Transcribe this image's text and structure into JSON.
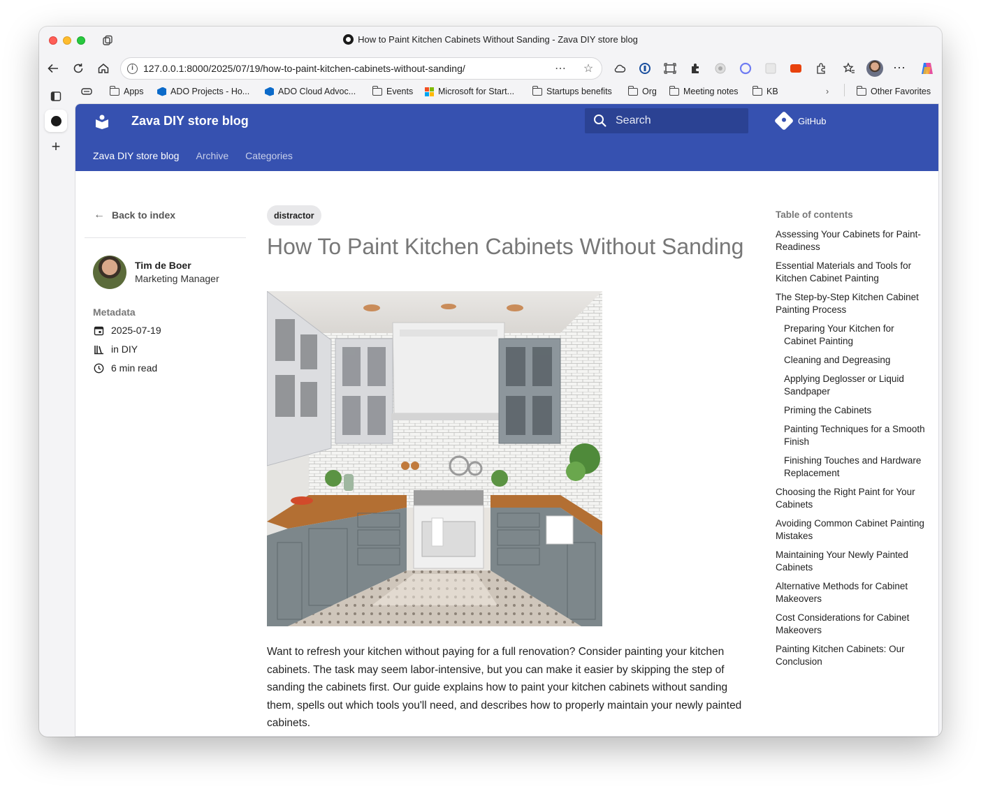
{
  "window": {
    "title": "How to Paint Kitchen Cabinets Without Sanding - Zava DIY store blog"
  },
  "browser": {
    "url": "127.0.0.1:8000/2025/07/19/how-to-paint-kitchen-cabinets-without-sanding/",
    "bookmarks": [
      {
        "label": "Apps",
        "icon": "folder-icon"
      },
      {
        "label": "ADO Projects - Ho...",
        "icon": "azure-devops-icon"
      },
      {
        "label": "ADO Cloud Advoc...",
        "icon": "azure-devops-icon"
      },
      {
        "label": "Events",
        "icon": "folder-icon"
      },
      {
        "label": "Microsoft for Start...",
        "icon": "microsoft-icon"
      },
      {
        "label": "Startups benefits",
        "icon": "folder-icon"
      },
      {
        "label": "Org",
        "icon": "folder-icon"
      },
      {
        "label": "Meeting notes",
        "icon": "folder-icon"
      },
      {
        "label": "KB",
        "icon": "folder-icon"
      }
    ],
    "other_favorites": "Other Favorites"
  },
  "site": {
    "title": "Zava DIY store blog",
    "search_placeholder": "Search",
    "github": "GitHub",
    "nav": [
      "Zava DIY store blog",
      "Archive",
      "Categories"
    ],
    "header_color": "#3651b0"
  },
  "sidebar": {
    "back": "Back to index",
    "author_name": "Tim de Boer",
    "author_role": "Marketing Manager",
    "metadata_heading": "Metadata",
    "date": "2025-07-19",
    "category": "in DIY",
    "read_time": "6 min read"
  },
  "post": {
    "tag": "distractor",
    "title": "How To Paint Kitchen Cabinets Without Sanding",
    "intro": "Want to refresh your kitchen without paying for a full renovation? Consider painting your kitchen cabinets. The task may seem labor-intensive, but you can make it easier by skipping the step of sanding the cabinets first. Our guide explains how to paint your kitchen cabinets without sanding them, spells out which tools you'll need, and describes how to properly maintain your newly painted cabinets."
  },
  "toc": {
    "heading": "Table of contents",
    "items": [
      {
        "label": "Assessing Your Cabinets for Paint-Readiness",
        "level": 1
      },
      {
        "label": "Essential Materials and Tools for Kitchen Cabinet Painting",
        "level": 1
      },
      {
        "label": "The Step-by-Step Kitchen Cabinet Painting Process",
        "level": 1
      },
      {
        "label": "Preparing Your Kitchen for Cabinet Painting",
        "level": 2
      },
      {
        "label": "Cleaning and Degreasing",
        "level": 2
      },
      {
        "label": "Applying Deglosser or Liquid Sandpaper",
        "level": 2
      },
      {
        "label": "Priming the Cabinets",
        "level": 2
      },
      {
        "label": "Painting Techniques for a Smooth Finish",
        "level": 2
      },
      {
        "label": "Finishing Touches and Hardware Replacement",
        "level": 2
      },
      {
        "label": "Choosing the Right Paint for Your Cabinets",
        "level": 1
      },
      {
        "label": "Avoiding Common Cabinet Painting Mistakes",
        "level": 1
      },
      {
        "label": "Maintaining Your Newly Painted Cabinets",
        "level": 1
      },
      {
        "label": "Alternative Methods for Cabinet Makeovers",
        "level": 1
      },
      {
        "label": "Cost Considerations for Cabinet Makeovers",
        "level": 1
      },
      {
        "label": "Painting Kitchen Cabinets: Our Conclusion",
        "level": 1
      }
    ]
  }
}
